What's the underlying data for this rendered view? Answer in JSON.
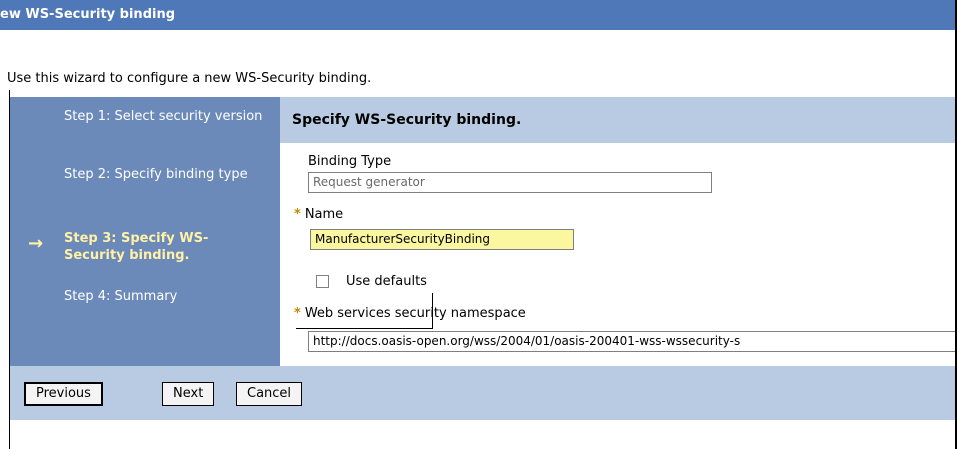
{
  "window": {
    "title": "ew WS-Security binding"
  },
  "intro": "Use this wizard to configure a new WS-Security binding.",
  "steps": [
    {
      "label": "Step 1: Select security version",
      "current": false
    },
    {
      "label": "Step 2: Specify binding type",
      "current": false
    },
    {
      "label": "Step 3: Specify WS-Security binding.",
      "current": true
    },
    {
      "label": "Step 4: Summary",
      "current": false
    }
  ],
  "content": {
    "heading": "Specify WS-Security binding.",
    "binding_type": {
      "label": "Binding Type",
      "value": "Request generator"
    },
    "name": {
      "label": "Name",
      "value": "ManufacturerSecurityBinding",
      "required_marker": "*"
    },
    "use_defaults": {
      "label": "Use defaults",
      "checked": false
    },
    "namespace": {
      "label": "Web services security namespace",
      "value": "http://docs.oasis-open.org/wss/2004/01/oasis-200401-wss-wssecurity-s",
      "required_marker": "*"
    }
  },
  "buttons": {
    "previous": "Previous",
    "next": "Next",
    "cancel": "Cancel"
  },
  "colors": {
    "title_bar": "#4f78b8",
    "sidebar": "#6c8ab9",
    "header": "#b9cbe3",
    "current_step": "#fff1a6",
    "name_highlight": "#fbf7a0"
  }
}
